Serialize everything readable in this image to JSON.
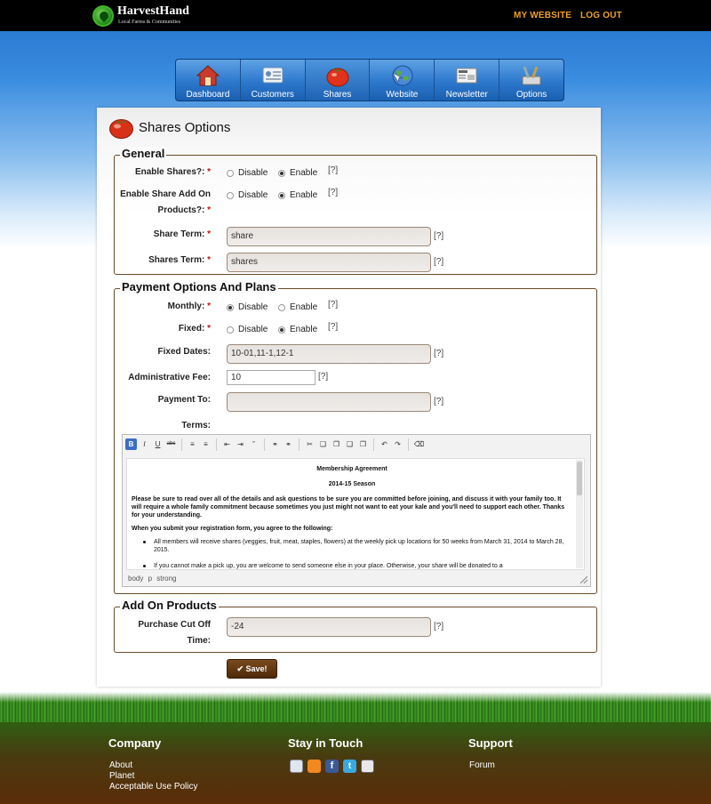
{
  "brand": {
    "name": "HarvestHand",
    "tagline": "Local Farms & Communities"
  },
  "toplinks": {
    "my_website": "MY WEBSITE",
    "logout": "LOG OUT"
  },
  "nav": [
    "Dashboard",
    "Customers",
    "Shares",
    "Website",
    "Newsletter",
    "Options"
  ],
  "page": {
    "title": "Shares Options"
  },
  "general": {
    "legend": "General",
    "enable_shares": {
      "label": "Enable Shares?:",
      "options": [
        "Disable",
        "Enable"
      ],
      "selected": "Enable"
    },
    "enable_addon": {
      "label": "Enable Share Add On Products?:",
      "options": [
        "Disable",
        "Enable"
      ],
      "selected": "Enable"
    },
    "share_term": {
      "label": "Share Term:",
      "value": "share"
    },
    "shares_term": {
      "label": "Shares Term:",
      "value": "shares"
    }
  },
  "payment": {
    "legend": "Payment Options And Plans",
    "monthly": {
      "label": "Monthly:",
      "options": [
        "Disable",
        "Enable"
      ],
      "selected": "Disable"
    },
    "fixed": {
      "label": "Fixed:",
      "options": [
        "Disable",
        "Enable"
      ],
      "selected": "Disable"
    },
    "fixed_dates": {
      "label": "Fixed Dates:",
      "value": "10-01,11-1,12-1"
    },
    "admin_fee": {
      "label": "Administrative Fee:",
      "value": "10"
    },
    "payment_to": {
      "label": "Payment To:",
      "value": ""
    },
    "terms_label": "Terms:"
  },
  "editor": {
    "doc_title": "Membership Agreement",
    "doc_season": "2014-15 Season",
    "intro": "Please be sure to read over all of the details and ask questions to be sure you are committed before joining, and discuss it with your family too. It will require a whole family commitment because sometimes you just might not want to eat your kale and you'll need to support each other. Thanks for your understanding.",
    "agree": "When you submit your registration form, you agree to the following:",
    "items": [
      "All members will receive shares (veggies, fruit, meat, staples, flowers) at the weekly pick up locations for 50 weeks from March 31, 2014 to March 28, 2015.",
      "If you cannot make a pick up, you are welcome to send someone else in your place. Otherwise, your share will be donated to a"
    ],
    "path": "body  p  strong",
    "toolbar": [
      "B",
      "I",
      "U",
      "abc"
    ]
  },
  "addon": {
    "legend": "Add On Products",
    "cutoff": {
      "label": "Purchase Cut Off Time:",
      "value": "-24"
    }
  },
  "help_text": "[?]",
  "required_mark": "*",
  "save_label": "Save!",
  "footer": {
    "company": {
      "heading": "Company",
      "links": [
        "About",
        "Planet",
        "Acceptable Use Policy"
      ]
    },
    "stay": {
      "heading": "Stay in Touch",
      "icons": [
        "email-icon",
        "rss-icon",
        "facebook-icon",
        "twitter-icon",
        "github-icon"
      ]
    },
    "support": {
      "heading": "Support",
      "links": [
        "Forum"
      ]
    }
  },
  "colors": {
    "accent": "#f0a020",
    "brand_brown": "#5a2c08",
    "nav_blue": "#2d78cc"
  }
}
